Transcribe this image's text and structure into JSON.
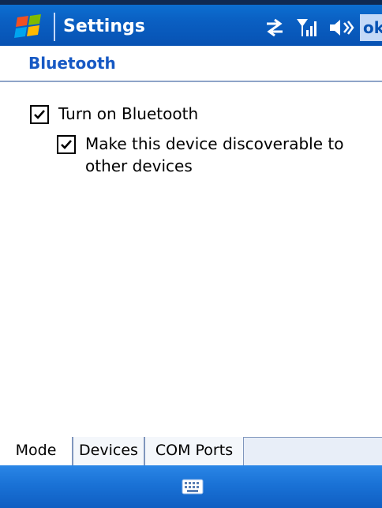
{
  "title_bar": {
    "app_title": "Settings",
    "ok_label": "ok",
    "status_icons": [
      "connectivity-icon",
      "signal-strength-icon",
      "volume-icon"
    ]
  },
  "page": {
    "title": "Bluetooth"
  },
  "options": [
    {
      "label": "Turn on Bluetooth",
      "checked": true
    },
    {
      "label": "Make this device discoverable to other devices",
      "checked": true
    }
  ],
  "tabs": [
    {
      "label": "Mode",
      "active": true
    },
    {
      "label": "Devices",
      "active": false
    },
    {
      "label": "COM Ports",
      "active": false
    }
  ],
  "bottom_bar": {
    "icon": "keyboard-icon"
  },
  "colors": {
    "title_bar_blue": "#0a5fc2",
    "header_text_blue": "#1759c4",
    "bottom_bar_blue": "#1a72d6"
  }
}
